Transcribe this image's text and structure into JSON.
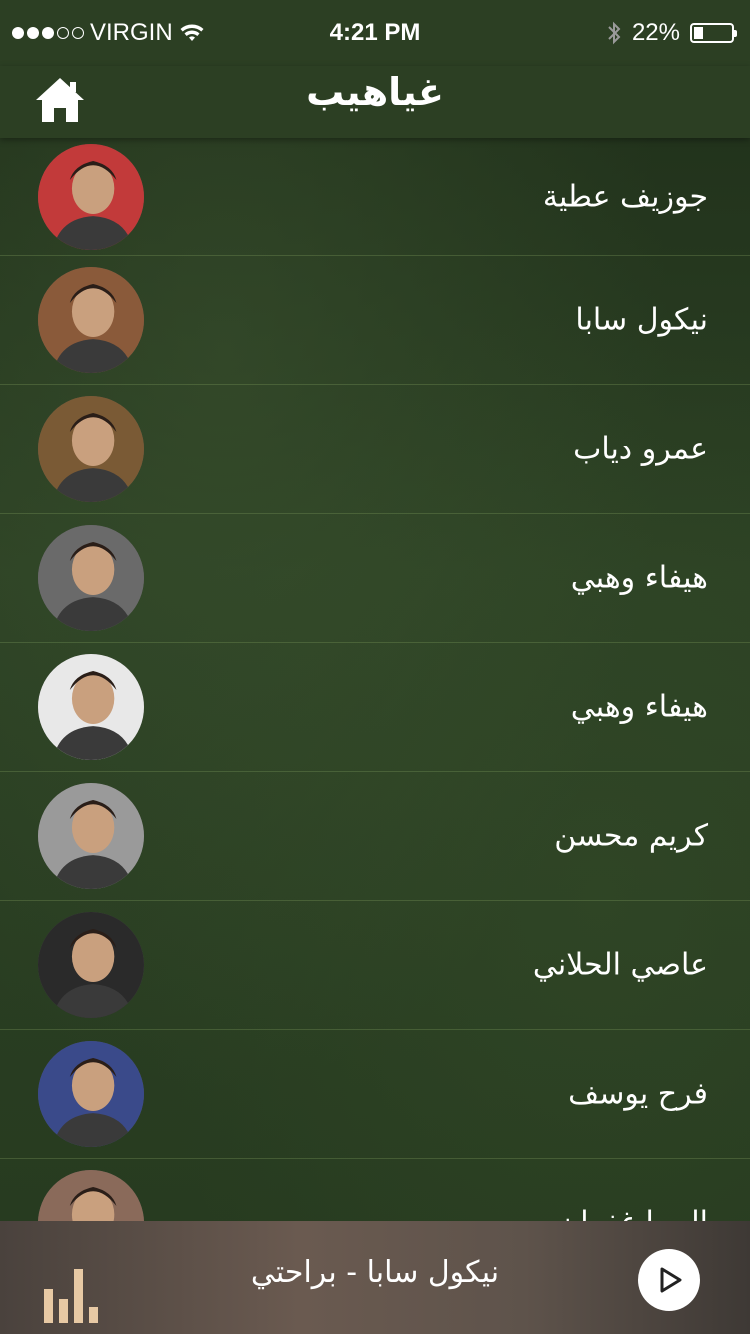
{
  "status_bar": {
    "carrier": "VIRGIN",
    "time": "4:21 PM",
    "battery_percent_text": "22%",
    "battery_level": 0.22,
    "signal_bars_filled": 3,
    "signal_bars_total": 5
  },
  "nav": {
    "title": "غياهيب",
    "home_icon": "home-icon"
  },
  "artists": [
    {
      "name": "جوزيف عطية",
      "avatar_bg": "#c23a3a"
    },
    {
      "name": "نيكول سابا",
      "avatar_bg": "#8a5a3a"
    },
    {
      "name": "عمرو دياب",
      "avatar_bg": "#7a5a35"
    },
    {
      "name": "هيفاء وهبي",
      "avatar_bg": "#6a6a6a"
    },
    {
      "name": "هيفاء وهبي",
      "avatar_bg": "#e8e8e8"
    },
    {
      "name": "كريم محسن",
      "avatar_bg": "#9a9a9a"
    },
    {
      "name": "عاصي الحلاني",
      "avatar_bg": "#2a2a2a"
    },
    {
      "name": "فرح يوسف",
      "avatar_bg": "#3a4a8a"
    },
    {
      "name": "إليسا غفران",
      "avatar_bg": "#8a6a5a"
    }
  ],
  "player": {
    "now_playing": "نيكول سابا - براحتي",
    "eq_icon": "equalizer-icon",
    "play_icon": "play-icon",
    "accent": "#e7c9a4"
  }
}
